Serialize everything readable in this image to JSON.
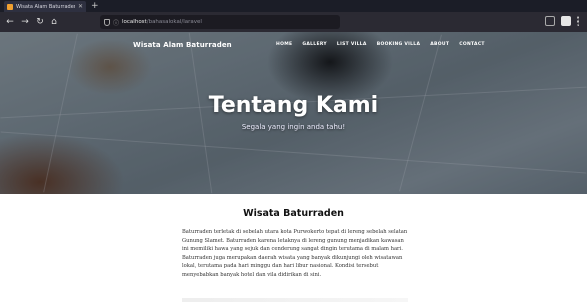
{
  "browser": {
    "tab_title": "Wisata Alam Baturraden - Tr",
    "url_host": "localhost",
    "url_path": "/bahasalokal/laravel"
  },
  "site": {
    "brand": "Wisata Alam Baturraden",
    "nav": [
      "HOME",
      "GALLERY",
      "LIST VILLA",
      "BOOKING VILLA",
      "ABOUT",
      "CONTACT"
    ]
  },
  "hero": {
    "title": "Tentang Kami",
    "subtitle": "Segala yang ingin anda tahu!"
  },
  "content": {
    "heading": "Wisata Baturraden",
    "paragraph": "Baturraden terletak di sebelah utara kota Purwokerto tepat di lereng sebelah selatan Gunung Slamet. Baturraden karena letaknya di lereng gunung menjadikan kawasan ini memiliki hawa yang sejuk dan cenderung sangat dingin terutama di malam hari. Baturraden juga merupakan daerah wisata yang banyak dikunjungi oleh wisatawan lokal, terutama pada hari minggu dan hari libur nasional. Kondisi tersebut menyebabkan banyak hotel dan vila didirikan di sini."
  }
}
